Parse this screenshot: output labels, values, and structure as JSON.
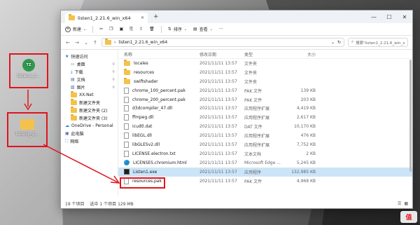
{
  "desktop": {
    "app_icon": {
      "label": "listen1_2...",
      "badge": "TZ"
    },
    "folder_icon": {
      "label": "listen1_2..."
    }
  },
  "window": {
    "tab_title": "listen1_2.21.6_win_x64",
    "tab_close": "✕",
    "tab_add": "+",
    "controls": {
      "minimize": "—",
      "maximize": "☐",
      "close": "✕"
    }
  },
  "toolbar": {
    "new_label": "新建",
    "sort_label": "排序",
    "view_label": "查看",
    "more": "···"
  },
  "address": {
    "path": "listen1_2.21.6_win_x64",
    "search_placeholder": "搜索\"listen1_2.21.6_win_x6..."
  },
  "sidebar": {
    "items": [
      {
        "label": "快速访问",
        "icon": "star-icon",
        "indent": false
      },
      {
        "label": "桌面",
        "icon": "desktop-icon",
        "indent": true,
        "pinned": true
      },
      {
        "label": "下载",
        "icon": "download-icon",
        "indent": true,
        "pinned": true
      },
      {
        "label": "文档",
        "icon": "document-icon",
        "indent": true,
        "pinned": true
      },
      {
        "label": "图片",
        "icon": "picture-icon",
        "indent": true,
        "pinned": true
      },
      {
        "label": "XX-Net",
        "icon": "folder-icon",
        "indent": true
      },
      {
        "label": "新建文件夹",
        "icon": "folder-icon",
        "indent": true
      },
      {
        "label": "新建文件夹 (2)",
        "icon": "folder-icon",
        "indent": true
      },
      {
        "label": "新建文件夹 (3)",
        "icon": "folder-icon",
        "indent": true
      },
      {
        "label": "OneDrive - Personal",
        "icon": "cloud-icon",
        "indent": false
      },
      {
        "label": "此电脑",
        "icon": "computer-icon",
        "indent": false
      },
      {
        "label": "网络",
        "icon": "network-icon",
        "indent": false
      }
    ]
  },
  "columns": {
    "name": "名称",
    "date": "修改日期",
    "type": "类型",
    "size": "大小"
  },
  "files": [
    {
      "name": "locales",
      "date": "2021/11/11 13:57",
      "type": "文件夹",
      "size": "",
      "icon": "folder"
    },
    {
      "name": "resources",
      "date": "2021/11/11 13:57",
      "type": "文件夹",
      "size": "",
      "icon": "folder"
    },
    {
      "name": "swiftshader",
      "date": "2021/11/11 13:57",
      "type": "文件夹",
      "size": "",
      "icon": "folder"
    },
    {
      "name": "chrome_100_percent.pak",
      "date": "2021/11/11 13:57",
      "type": "PAK 文件",
      "size": "139 KB",
      "icon": "file"
    },
    {
      "name": "chrome_200_percent.pak",
      "date": "2021/11/11 13:57",
      "type": "PAK 文件",
      "size": "203 KB",
      "icon": "file"
    },
    {
      "name": "d3dcompiler_47.dll",
      "date": "2021/11/11 13:57",
      "type": "应用程序扩展",
      "size": "4,419 KB",
      "icon": "file"
    },
    {
      "name": "ffmpeg.dll",
      "date": "2021/11/11 13:57",
      "type": "应用程序扩展",
      "size": "2,617 KB",
      "icon": "file"
    },
    {
      "name": "icudtl.dat",
      "date": "2021/11/11 13:57",
      "type": "DAT 文件",
      "size": "10,170 KB",
      "icon": "file"
    },
    {
      "name": "libEGL.dll",
      "date": "2021/11/11 13:57",
      "type": "应用程序扩展",
      "size": "476 KB",
      "icon": "file"
    },
    {
      "name": "libGLESv2.dll",
      "date": "2021/11/11 13:57",
      "type": "应用程序扩展",
      "size": "7,752 KB",
      "icon": "file"
    },
    {
      "name": "LICENSE.electron.txt",
      "date": "2021/11/11 13:57",
      "type": "文本文档",
      "size": "2 KB",
      "icon": "file"
    },
    {
      "name": "LICENSES.chromium.html",
      "date": "2021/11/11 13:57",
      "type": "Microsoft Edge ...",
      "size": "5,245 KB",
      "icon": "edge"
    },
    {
      "name": "Listen1.exe",
      "date": "2021/11/11 13:57",
      "type": "应用程序",
      "size": "132,985 KB",
      "icon": "exe",
      "selected": true
    },
    {
      "name": "resources.pak",
      "date": "2021/11/11 13:57",
      "type": "PAK 文件",
      "size": "4,968 KB",
      "icon": "file"
    }
  ],
  "status": {
    "count": "19 个项目",
    "selection": "选中 1 个项目 129 MB"
  },
  "watermark": "值"
}
